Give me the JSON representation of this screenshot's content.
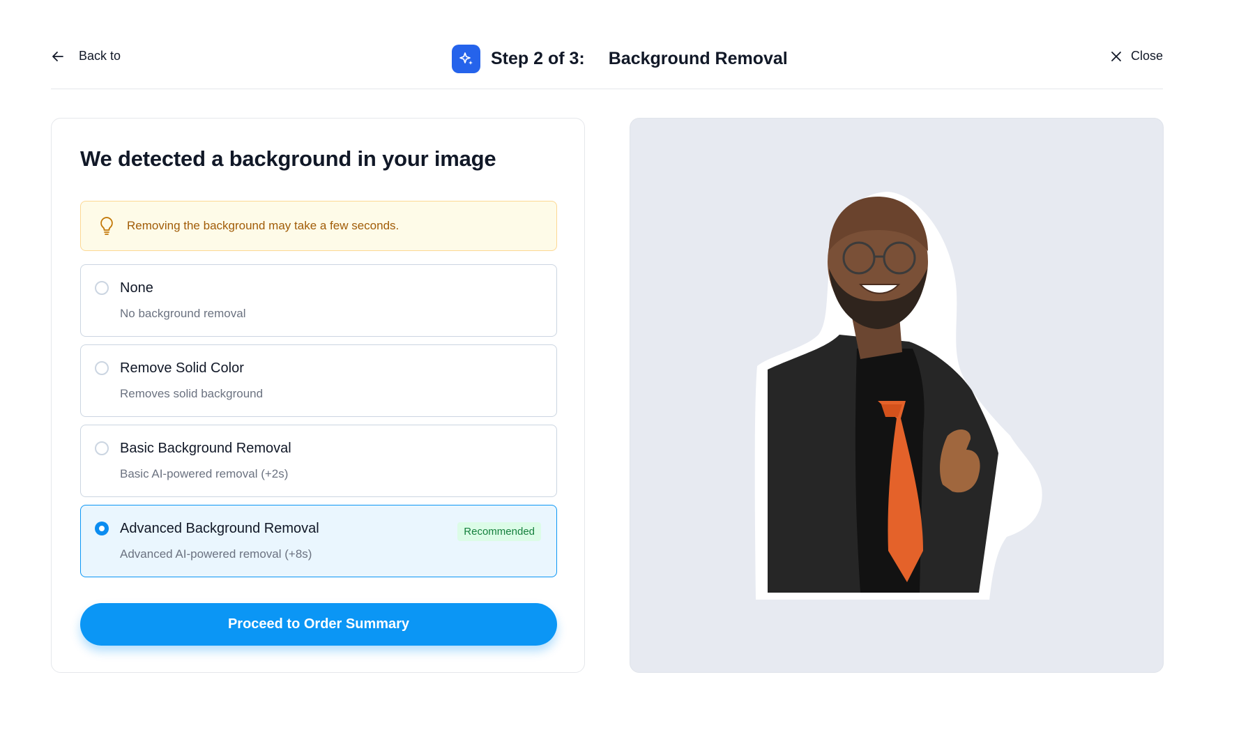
{
  "header": {
    "back_label": "Back to",
    "step_label": "Step 2 of 3:",
    "step_title": "Background Removal",
    "close_label": "Close"
  },
  "panel": {
    "heading": "We detected a background in your image",
    "tip": "Removing the background may take a few seconds.",
    "options": [
      {
        "name": "None",
        "description": "No background removal",
        "selected": false
      },
      {
        "name": "Remove Solid Color",
        "description": "Removes solid background",
        "selected": false
      },
      {
        "name": "Basic Background Removal",
        "description": "Basic AI-powered removal (+2s)",
        "selected": false
      },
      {
        "name": "Advanced Background Removal",
        "description": "Advanced AI-powered removal (+8s)",
        "selected": true,
        "badge": "Recommended"
      }
    ],
    "proceed_label": "Proceed to Order Summary"
  },
  "colors": {
    "accent": "#0b96f5",
    "step_badge": "#2563eb",
    "tip_bg": "#fefbe8",
    "tip_text": "#a15c07",
    "preview_bg": "#e7eaf1"
  }
}
